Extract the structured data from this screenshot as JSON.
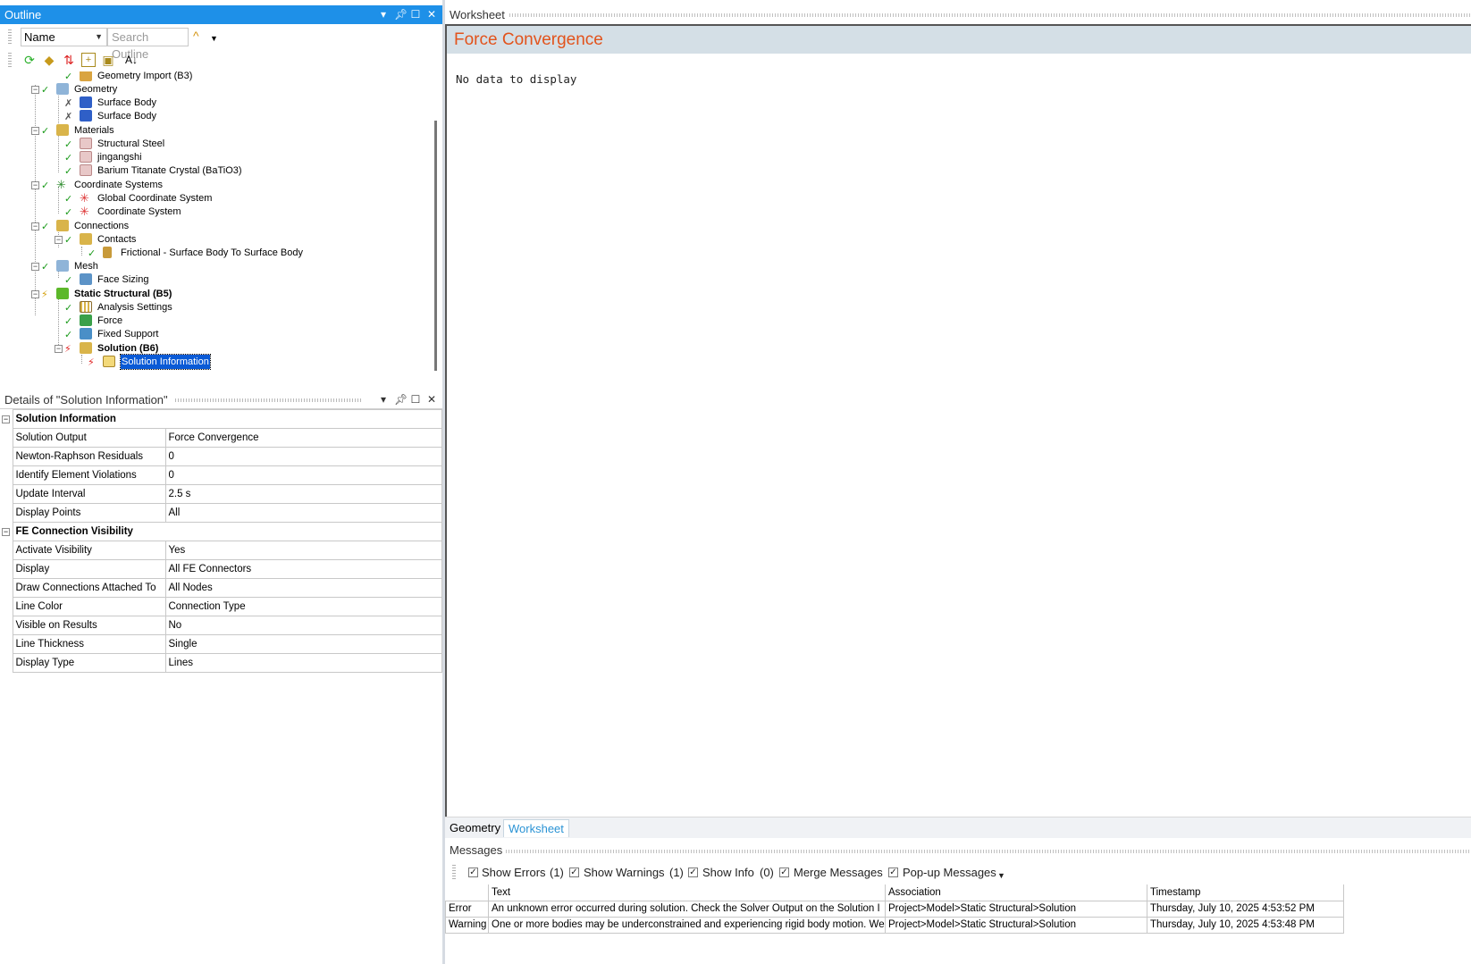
{
  "outline": {
    "title": "Outline",
    "name_select": "Name",
    "search_placeholder": "Search Outline",
    "tree": [
      {
        "label": "Geometry Import (B3)"
      },
      {
        "label": "Geometry"
      },
      {
        "label": "Surface Body"
      },
      {
        "label": "Surface Body"
      },
      {
        "label": "Materials"
      },
      {
        "label": "Structural Steel"
      },
      {
        "label": "jingangshi"
      },
      {
        "label": "Barium Titanate Crystal (BaTiO3)"
      },
      {
        "label": "Coordinate Systems"
      },
      {
        "label": "Global Coordinate System"
      },
      {
        "label": "Coordinate System"
      },
      {
        "label": "Connections"
      },
      {
        "label": "Contacts"
      },
      {
        "label": "Frictional - Surface Body To Surface Body"
      },
      {
        "label": "Mesh"
      },
      {
        "label": "Face Sizing"
      },
      {
        "label": "Static Structural (B5)"
      },
      {
        "label": "Analysis Settings"
      },
      {
        "label": "Force"
      },
      {
        "label": "Fixed Support"
      },
      {
        "label": "Solution (B6)"
      },
      {
        "label": "Solution Information"
      }
    ]
  },
  "details": {
    "title": "Details of \"Solution Information\"",
    "groups": [
      {
        "name": "Solution Information",
        "rows": [
          {
            "name": "Solution Output",
            "value": "Force Convergence"
          },
          {
            "name": "Newton-Raphson Residuals",
            "value": "0"
          },
          {
            "name": "Identify Element Violations",
            "value": "0"
          },
          {
            "name": "Update Interval",
            "value": "2.5 s"
          },
          {
            "name": "Display Points",
            "value": "All"
          }
        ]
      },
      {
        "name": "FE Connection Visibility",
        "rows": [
          {
            "name": "Activate Visibility",
            "value": "Yes"
          },
          {
            "name": "Display",
            "value": "All FE Connectors"
          },
          {
            "name": "Draw Connections Attached To",
            "value": "All Nodes"
          },
          {
            "name": "Line Color",
            "value": "Connection Type"
          },
          {
            "name": "Visible on Results",
            "value": "No"
          },
          {
            "name": "Line Thickness",
            "value": "Single"
          },
          {
            "name": "Display Type",
            "value": "Lines"
          }
        ]
      }
    ]
  },
  "worksheet": {
    "title": "Worksheet",
    "heading": "Force Convergence",
    "empty_text": "No data to display"
  },
  "tabs": [
    "Geometry",
    "Worksheet"
  ],
  "messages": {
    "title": "Messages",
    "toolbar": {
      "show_errors": "Show Errors",
      "errors_count": "(1)",
      "show_warnings": "Show Warnings",
      "warnings_count": "(1)",
      "show_info": "Show Info",
      "info_count": "(0)",
      "merge": "Merge Messages",
      "popup": "Pop-up Messages"
    },
    "columns": [
      "Text",
      "Association",
      "Timestamp"
    ],
    "rows": [
      {
        "type": "Error",
        "text": "An unknown error occurred during solution.  Check the Solver Output on the Solution I",
        "association": "Project>Model>Static Structural>Solution",
        "timestamp": "Thursday, July 10, 2025 4:53:52 PM"
      },
      {
        "type": "Warning",
        "text": "One or more bodies may be underconstrained and experiencing rigid body motion. Wea",
        "association": "Project>Model>Static Structural>Solution",
        "timestamp": "Thursday, July 10, 2025 4:53:48 PM"
      }
    ]
  },
  "colors": {
    "title_bar": "#1e90e8",
    "selection": "#0a5ad6",
    "worksheet_heading": "#e2531c",
    "worksheet_band": "#d4dfe6",
    "active_tab": "#2a93d5",
    "check": "#1a9a1a",
    "error_flash": "#e02020"
  }
}
